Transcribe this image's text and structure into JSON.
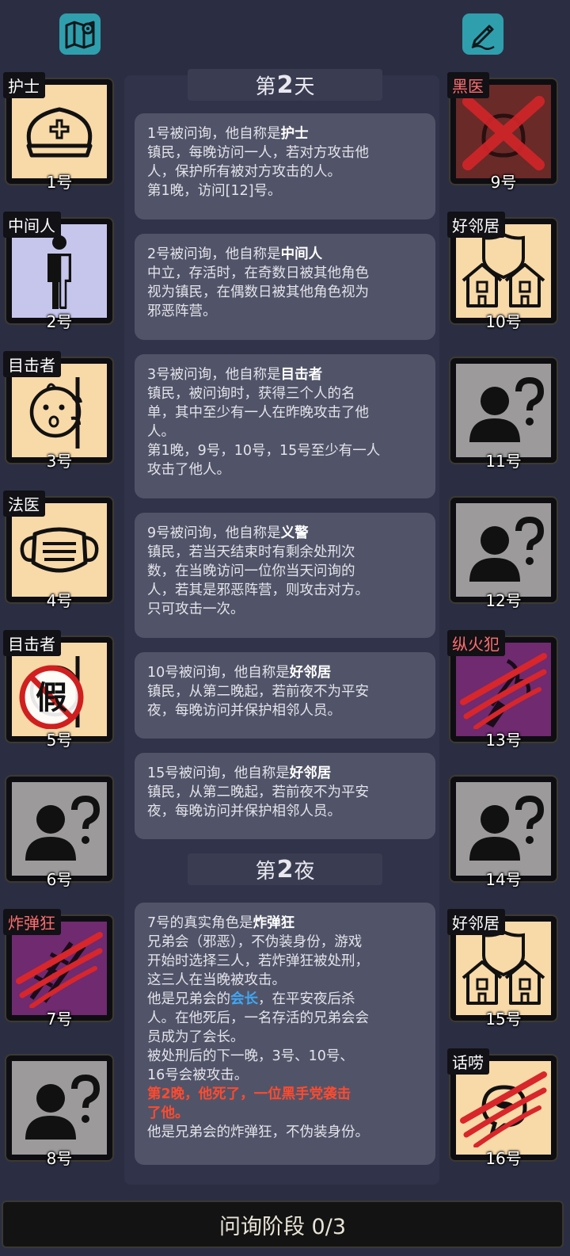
{
  "toolbar": {
    "map_icon": "map-pin-icon",
    "note_icon": "pen-note-icon"
  },
  "day_divider": {
    "prefix": "第",
    "num": "2",
    "suffix": "天"
  },
  "night_divider": {
    "prefix": "第",
    "num": "2",
    "suffix": "夜"
  },
  "cards": [
    {
      "l1a": "1号被问询，他自称是",
      "l1b": "护士",
      "lines": [
        "镇民，每晚访问一人，若对方攻击他",
        "人，保护所有被对方攻击的人。",
        "第1晚，访问[12]号。"
      ]
    },
    {
      "l1a": "2号被问询，他自称是",
      "l1b": "中间人",
      "lines": [
        "中立，存活时，在奇数日被其他角色",
        "视为镇民，在偶数日被其他角色视为",
        "邪恶阵营。"
      ]
    },
    {
      "l1a": "3号被问询，他自称是",
      "l1b": "目击者",
      "lines": [
        "镇民，被问询时，获得三个人的名",
        "单，其中至少有一人在昨晚攻击了他",
        "人。",
        "第1晚，9号，10号，15号至少有一人",
        "攻击了他人。"
      ]
    },
    {
      "l1a": "9号被问询，他自称是",
      "l1b": "义警",
      "lines": [
        "镇民，若当天结束时有剩余处刑次",
        "数，在当晚访问一位你当天问询的",
        "人，若其是邪恶阵营，则攻击对方。",
        "只可攻击一次。"
      ]
    },
    {
      "l1a": "10号被问询，他自称是",
      "l1b": "好邻居",
      "lines": [
        "镇民，从第二晚起，若前夜不为平安",
        "夜，每晚访问并保护相邻人员。"
      ]
    },
    {
      "l1a": "15号被问询，他自称是",
      "l1b": "好邻居",
      "lines": [
        "镇民，从第二晚起，若前夜不为平安",
        "夜，每晚访问并保护相邻人员。"
      ]
    }
  ],
  "night_card": {
    "l1a": "7号的真实角色是",
    "l1b": "炸弹狂",
    "l2": "兄弟会（邪恶），不伪装身份，游戏",
    "l3": "开始时选择三人，若炸弹狂被处刑，",
    "l4": "这三人在当晚被攻击。",
    "l5a": "他是兄弟会的",
    "l5b": "会长",
    "l5c": "，在平安夜后杀",
    "l6": "人。在他死后，一名存活的兄弟会会",
    "l7": "员成为了会长。",
    "l8": "被处刑后的下一晚，3号、10号、",
    "l9": "16号会被攻击。",
    "l10": "第2晚，他死了，一位黑手党袭击",
    "l11": "了他。",
    "l12": "他是兄弟会的炸弹狂，不伪装身份。"
  },
  "left_players": [
    {
      "role": "护士",
      "num": "1号",
      "icon": "nurse-cap-icon"
    },
    {
      "role": "中间人",
      "num": "2号",
      "icon": "person-half-icon"
    },
    {
      "role": "目击者",
      "num": "3号",
      "icon": "peeking-face-icon"
    },
    {
      "role": "法医",
      "num": "4号",
      "icon": "face-mask-icon"
    },
    {
      "role": "目击者",
      "num": "5号",
      "icon": "fake-stamp-icon"
    },
    {
      "role": "",
      "num": "6号",
      "icon": "unknown-person-icon"
    },
    {
      "role": "炸弹狂",
      "num": "7号",
      "icon": "bomber-slashed-icon"
    },
    {
      "role": "",
      "num": "8号",
      "icon": "unknown-person-icon"
    }
  ],
  "right_players": [
    {
      "role": "黑医",
      "num": "9号",
      "icon": "crossed-out-icon"
    },
    {
      "role": "好邻居",
      "num": "10号",
      "icon": "houses-shield-icon"
    },
    {
      "role": "",
      "num": "11号",
      "icon": "unknown-person-icon"
    },
    {
      "role": "",
      "num": "12号",
      "icon": "unknown-person-icon"
    },
    {
      "role": "纵火犯",
      "num": "13号",
      "icon": "arsonist-slashed-icon"
    },
    {
      "role": "",
      "num": "14号",
      "icon": "unknown-person-icon"
    },
    {
      "role": "好邻居",
      "num": "15号",
      "icon": "houses-shield-icon"
    },
    {
      "role": "话唠",
      "num": "16号",
      "icon": "chatter-slashed-icon"
    }
  ],
  "status": {
    "phase": "问询阶段 0/3"
  },
  "colors": {
    "background": "#2b2e42",
    "card": "#515468",
    "tile_tan": "#f8d9a8",
    "tile_gray": "#9c9a9b",
    "tile_evil": "#6f2a70",
    "tile_darkred": "#6a2a28",
    "accent_teal": "#2f9fae",
    "highlight_blue": "#3fa7f5",
    "highlight_red": "#ff4a2e"
  }
}
